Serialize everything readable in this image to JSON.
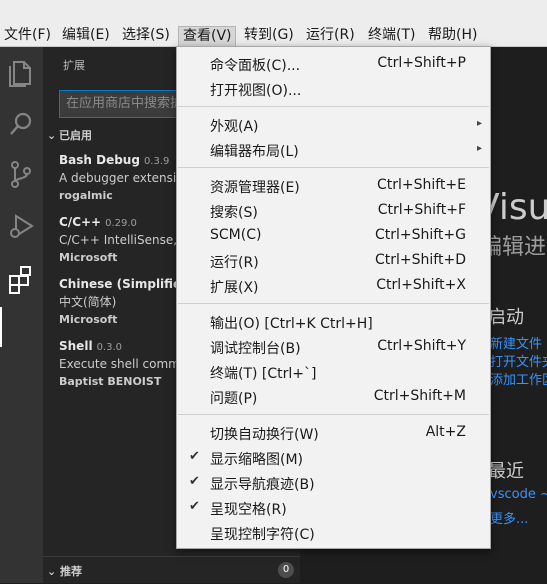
{
  "menubar": {
    "items": [
      "文件(F)",
      "编辑(E)",
      "选择(S)",
      "查看(V)",
      "转到(G)",
      "运行(R)",
      "终端(T)",
      "帮助(H)"
    ],
    "active": "查看(V)"
  },
  "sidebar": {
    "title": "扩展",
    "search_placeholder": "在应用商店中搜索扩展",
    "installed_label": "已启用",
    "extensions": [
      {
        "name": "Bash Debug",
        "version": "0.3.9",
        "description": "A debugger extension for bash scripts",
        "publisher": "rogalmic"
      },
      {
        "name": "C/C++",
        "version": "0.29.0",
        "description": "C/C++ IntelliSense, debugging, and code browsing.",
        "publisher": "Microsoft"
      },
      {
        "name": "Chinese (Simplified) Language Pack",
        "version": "",
        "description": "中文(简体)",
        "publisher": "Microsoft"
      },
      {
        "name": "Shell",
        "version": "0.3.0",
        "description": "Execute shell commands",
        "publisher": "Baptist BENOIST"
      }
    ],
    "recommended_label": "推荐",
    "recommended_count": "0"
  },
  "editor": {
    "title": "Visual Studio Code",
    "subtitle": "编辑进化",
    "start_heading": "启动",
    "start_links": [
      "新建文件",
      "打开文件夹...",
      "添加工作区文件夹..."
    ],
    "recent_heading": "最近",
    "recent_items": [
      "vscode  ~",
      "更多..."
    ]
  },
  "view_menu": {
    "groups": [
      [
        {
          "label": "命令面板(C)...",
          "shortcut": "Ctrl+Shift+P"
        },
        {
          "label": "打开视图(O)...",
          "shortcut": ""
        }
      ],
      [
        {
          "label": "外观(A)",
          "submenu": true
        },
        {
          "label": "编辑器布局(L)",
          "submenu": true
        }
      ],
      [
        {
          "label": "资源管理器(E)",
          "shortcut": "Ctrl+Shift+E"
        },
        {
          "label": "搜索(S)",
          "shortcut": "Ctrl+Shift+F"
        },
        {
          "label": "SCM(C)",
          "shortcut": "Ctrl+Shift+G"
        },
        {
          "label": "运行(R)",
          "shortcut": "Ctrl+Shift+D"
        },
        {
          "label": "扩展(X)",
          "shortcut": "Ctrl+Shift+X"
        }
      ],
      [
        {
          "label": "输出(O) [Ctrl+K Ctrl+H]",
          "shortcut": ""
        },
        {
          "label": "调试控制台(B)",
          "shortcut": "Ctrl+Shift+Y"
        },
        {
          "label": "终端(T) [Ctrl+`]",
          "shortcut": ""
        },
        {
          "label": "问题(P)",
          "shortcut": "Ctrl+Shift+M"
        }
      ],
      [
        {
          "label": "切换自动换行(W)",
          "shortcut": "Alt+Z",
          "checked": false
        },
        {
          "label": "显示缩略图(M)",
          "shortcut": "",
          "checked": true
        },
        {
          "label": "显示导航痕迹(B)",
          "shortcut": "",
          "checked": true
        },
        {
          "label": "呈现空格(R)",
          "shortcut": "",
          "checked": true
        },
        {
          "label": "呈现控制字符(C)",
          "shortcut": "",
          "checked": false
        }
      ]
    ]
  },
  "icons": [
    "files-icon",
    "search-icon",
    "source-control-icon",
    "run-debug-icon",
    "extensions-icon"
  ],
  "colors": {
    "accent": "#007acc",
    "link": "#3794ff",
    "activitybar": "#333333",
    "sidebar": "#252526",
    "editor": "#1e1e1e",
    "menu": "#f2f2f2"
  }
}
